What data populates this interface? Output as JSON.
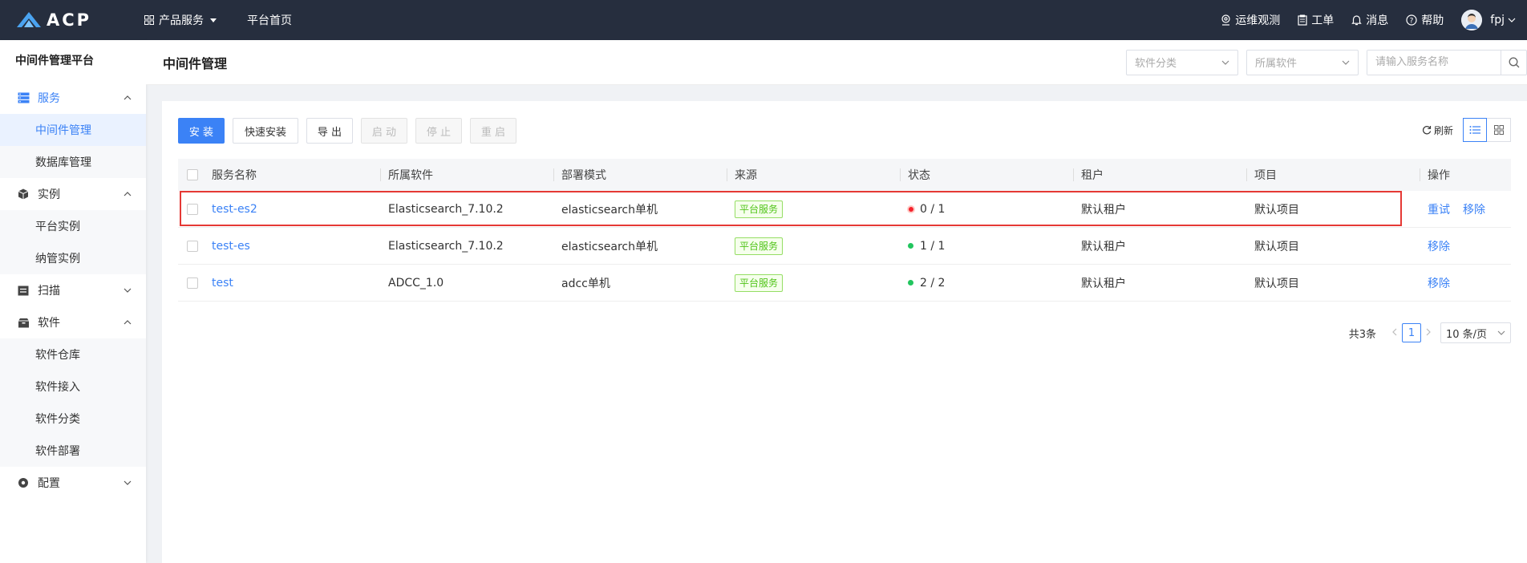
{
  "topbar": {
    "logo_text": "ACP",
    "nav": [
      {
        "label": "产品服务"
      },
      {
        "label": "平台首页"
      }
    ],
    "right": {
      "ops_label": "运维观测",
      "ticket_label": "工单",
      "message_label": "消息",
      "help_label": "帮助",
      "username": "fpj"
    }
  },
  "sidebar": {
    "title": "中间件管理平台",
    "groups": [
      {
        "label": "服务",
        "items": [
          "中间件管理",
          "数据库管理"
        ]
      },
      {
        "label": "实例",
        "items": [
          "平台实例",
          "纳管实例"
        ]
      },
      {
        "label": "扫描"
      },
      {
        "label": "软件",
        "items": [
          "软件仓库",
          "软件接入",
          "软件分类",
          "软件部署"
        ]
      },
      {
        "label": "配置"
      }
    ]
  },
  "header": {
    "title": "中间件管理",
    "filter_category_placeholder": "软件分类",
    "filter_software_placeholder": "所属软件",
    "search_placeholder": "请输入服务名称"
  },
  "toolbar": {
    "install": "安 装",
    "quick_install": "快速安装",
    "export": "导 出",
    "start": "启 动",
    "stop": "停 止",
    "restart": "重 启",
    "refresh": "刷新"
  },
  "table": {
    "columns": [
      "服务名称",
      "所属软件",
      "部署模式",
      "来源",
      "状态",
      "租户",
      "项目",
      "操作"
    ],
    "rows": [
      {
        "name": "test-es2",
        "software": "Elasticsearch_7.10.2",
        "mode": "elasticsearch单机",
        "source": "平台服务",
        "status": "0 / 1",
        "status_color": "#f5222d",
        "tenant": "默认租户",
        "project": "默认项目",
        "ops": [
          "重试",
          "移除"
        ]
      },
      {
        "name": "test-es",
        "software": "Elasticsearch_7.10.2",
        "mode": "elasticsearch单机",
        "source": "平台服务",
        "status": "1 / 1",
        "status_color": "#22c55e",
        "tenant": "默认租户",
        "project": "默认项目",
        "ops": [
          "移除"
        ]
      },
      {
        "name": "test",
        "software": "ADCC_1.0",
        "mode": "adcc单机",
        "source": "平台服务",
        "status": "2 / 2",
        "status_color": "#22c55e",
        "tenant": "默认租户",
        "project": "默认项目",
        "ops": [
          "移除"
        ]
      }
    ]
  },
  "pagination": {
    "total_label": "共3条",
    "current_page": "1",
    "page_size": "10 条/页"
  },
  "colors": {
    "accent": "#3b82f6",
    "topbar_bg": "#262e3e",
    "error": "#f5222d",
    "success": "#22c55e"
  }
}
